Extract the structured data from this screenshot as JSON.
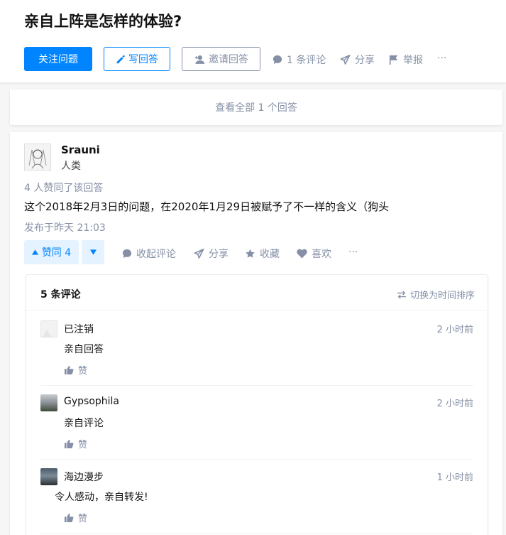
{
  "question": {
    "title": "亲自上阵是怎样的体验?",
    "follow_label": "关注问题",
    "write_label": "写回答",
    "invite_label": "邀请回答",
    "comments_label": "1 条评论",
    "share_label": "分享",
    "report_label": "举报",
    "more_label": "···"
  },
  "view_all_label": "查看全部 1 个回答",
  "answer": {
    "author_name": "Srauni",
    "author_bio": "人类",
    "votes_line": "4 人赞同了该回答",
    "content": "这个2018年2月3日的问题，在2020年1月29日被赋予了不一样的含义（狗头",
    "published": "发布于昨天 21:03",
    "upvote_label": "赞同 4",
    "collapse_comments_label": "收起评论",
    "share_label": "分享",
    "collect_label": "收藏",
    "like_label": "喜欢",
    "more_label": "···"
  },
  "comments": {
    "count_label": "5 条评论",
    "sort_label": "切换为时间排序",
    "items": [
      {
        "author": "已注销",
        "time": "2 小时前",
        "text": "亲自回答",
        "like_label": "赞"
      },
      {
        "author": "Gypsophila",
        "time": "2 小时前",
        "text": "亲自评论",
        "like_label": "赞"
      },
      {
        "author": "海边漫步",
        "time": "1 小时前",
        "text": "令人感动，亲自转发!",
        "like_label": "赞"
      }
    ]
  },
  "colors": {
    "brand_blue": "#0084ff",
    "light_blue": "#e5f2ff",
    "gray_text": "#8590a6"
  },
  "icons": [
    "pencil-icon",
    "add-user-icon",
    "comment-icon",
    "send-icon",
    "flag-icon",
    "triangle-up-icon",
    "triangle-down-icon",
    "star-icon",
    "heart-icon",
    "swap-icon",
    "thumbs-up-icon"
  ]
}
